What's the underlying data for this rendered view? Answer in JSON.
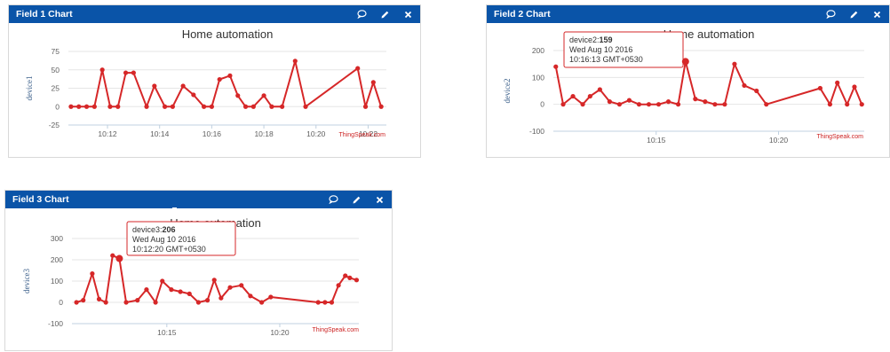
{
  "widgets": [
    {
      "header": "Field 1 Chart",
      "icons": [
        "comment-icon",
        "pencil-icon",
        "close-icon"
      ],
      "chart_data": {
        "type": "line",
        "title": "Home automation",
        "ylabel": "device1",
        "credit": "ThingSpeak.com",
        "ylim": [
          -25,
          75
        ],
        "yticks": [
          -25,
          0,
          25,
          50,
          75
        ],
        "xlim": [
          10.5,
          22.7
        ],
        "xticks": [
          {
            "v": 12,
            "label": "10:12"
          },
          {
            "v": 14,
            "label": "10:14"
          },
          {
            "v": 16,
            "label": "10:16"
          },
          {
            "v": 18,
            "label": "10:18"
          },
          {
            "v": 20,
            "label": "10:20"
          },
          {
            "v": 22,
            "label": "10:22"
          }
        ],
        "series": [
          {
            "x": [
              10.6,
              10.9,
              11.2,
              11.5,
              11.8,
              12.1,
              12.4,
              12.7,
              13.0,
              13.5,
              13.8,
              14.2,
              14.5,
              14.9,
              15.3,
              15.7,
              16.0,
              16.3,
              16.7,
              17.0,
              17.3,
              17.6,
              18.0,
              18.3,
              18.7,
              19.2,
              19.6,
              21.6,
              21.9,
              22.2,
              22.5
            ],
            "y": [
              0,
              0,
              0,
              0,
              50,
              0,
              0,
              46,
              46,
              0,
              28,
              0,
              0,
              28,
              16,
              0,
              0,
              37,
              42,
              15,
              0,
              0,
              15,
              0,
              0,
              62,
              0,
              52,
              0,
              33,
              0
            ]
          }
        ],
        "tooltip": null
      }
    },
    {
      "header": "Field 2 Chart",
      "icons": [
        "comment-icon",
        "pencil-icon",
        "close-icon"
      ],
      "chart_data": {
        "type": "line",
        "title": "Home automation",
        "ylabel": "device2",
        "credit": "ThingSpeak.com",
        "ylim": [
          -100,
          200
        ],
        "yticks": [
          -100,
          0,
          100,
          200
        ],
        "xlim": [
          10.8,
          23.5
        ],
        "xticks": [
          {
            "v": 15,
            "label": "10:15"
          },
          {
            "v": 20,
            "label": "10:20"
          }
        ],
        "series": [
          {
            "x": [
              10.9,
              11.2,
              11.6,
              12.0,
              12.3,
              12.7,
              13.1,
              13.5,
              13.9,
              14.3,
              14.7,
              15.1,
              15.5,
              15.9,
              16.2,
              16.6,
              17.0,
              17.4,
              17.8,
              18.2,
              18.6,
              19.1,
              19.5,
              21.7,
              22.1,
              22.4,
              22.8,
              23.1,
              23.4
            ],
            "y": [
              140,
              0,
              30,
              0,
              30,
              55,
              10,
              0,
              15,
              0,
              0,
              0,
              10,
              0,
              159,
              20,
              10,
              0,
              0,
              150,
              70,
              50,
              0,
              60,
              0,
              80,
              0,
              65,
              0
            ]
          }
        ],
        "tooltip": {
          "series": "device2",
          "value": "159",
          "date": "Wed Aug 10 2016",
          "time": "10:16:13 GMT+0530"
        }
      }
    },
    {
      "header": "Field 3 Chart",
      "icons": [
        "comment-icon",
        "pencil-icon",
        "close-icon"
      ],
      "chart_data": {
        "type": "line",
        "title": "Home automation",
        "ylabel": "device3",
        "credit": "ThingSpeak.com",
        "ylim": [
          -100,
          300
        ],
        "yticks": [
          -100,
          0,
          100,
          200,
          300
        ],
        "xlim": [
          10.8,
          23.5
        ],
        "xticks": [
          {
            "v": 15,
            "label": "10:15"
          },
          {
            "v": 20,
            "label": "10:20"
          }
        ],
        "series": [
          {
            "x": [
              11.0,
              11.3,
              11.7,
              12.0,
              12.3,
              12.6,
              12.9,
              13.2,
              13.7,
              14.1,
              14.5,
              14.8,
              15.2,
              15.6,
              16.0,
              16.4,
              16.8,
              17.1,
              17.4,
              17.8,
              18.3,
              18.7,
              19.2,
              19.6,
              21.7,
              22.0,
              22.3,
              22.6,
              22.9,
              23.1,
              23.4
            ],
            "y": [
              0,
              10,
              135,
              15,
              0,
              220,
              206,
              0,
              10,
              60,
              0,
              100,
              60,
              50,
              40,
              0,
              10,
              105,
              20,
              70,
              80,
              30,
              0,
              25,
              0,
              0,
              0,
              80,
              125,
              115,
              105
            ]
          }
        ],
        "tooltip": {
          "series": "device3",
          "value": "206",
          "date": "Wed Aug 10 2016",
          "time": "10:12:20 GMT+0530"
        }
      }
    }
  ]
}
